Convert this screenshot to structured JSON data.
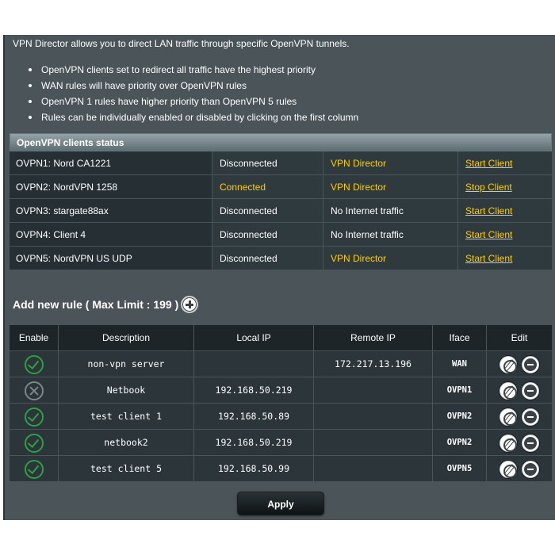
{
  "intro": "VPN Director allows you to direct LAN traffic through specific OpenVPN tunnels.",
  "bullets": [
    "OpenVPN clients set to redirect all traffic have the highest priority",
    "WAN rules will have priority over OpenVPN rules",
    "OpenVPN 1 rules have higher priority than OpenVPN 5 rules",
    "Rules can be individually enabled or disabled by clicking on the first column"
  ],
  "status": {
    "title": "OpenVPN clients status",
    "rows": [
      {
        "name": "OVPN1: Nord CA1221",
        "state": "Disconnected",
        "mode": "VPN Director",
        "action": "Start Client"
      },
      {
        "name": "OVPN2: NordVPN 1258",
        "state": "Connected",
        "mode": "VPN Director",
        "action": "Stop Client"
      },
      {
        "name": "OVPN3: stargate88ax",
        "state": "Disconnected",
        "mode": "No Internet traffic",
        "action": "Start Client"
      },
      {
        "name": "OVPN4: Client 4",
        "state": "Disconnected",
        "mode": "No Internet traffic",
        "action": "Start Client"
      },
      {
        "name": "OVPN5: NordVPN US UDP",
        "state": "Disconnected",
        "mode": "VPN Director",
        "action": "Start Client"
      }
    ]
  },
  "add_rule": {
    "label": "Add new rule ( Max Limit : 199 )",
    "icon": "plus-circle-icon"
  },
  "rules": {
    "headers": {
      "enable": "Enable",
      "description": "Description",
      "local_ip": "Local IP",
      "remote_ip": "Remote IP",
      "iface": "Iface",
      "edit": "Edit"
    },
    "rows": [
      {
        "enabled": true,
        "description": "non-vpn server",
        "local_ip": "",
        "remote_ip": "172.217.13.196",
        "iface": "WAN"
      },
      {
        "enabled": false,
        "description": "Netbook",
        "local_ip": "192.168.50.219",
        "remote_ip": "",
        "iface": "OVPN1"
      },
      {
        "enabled": true,
        "description": "test client 1",
        "local_ip": "192.168.50.89",
        "remote_ip": "",
        "iface": "OVPN2"
      },
      {
        "enabled": true,
        "description": "netbook2",
        "local_ip": "192.168.50.219",
        "remote_ip": "",
        "iface": "OVPN2"
      },
      {
        "enabled": true,
        "description": "test client 5",
        "local_ip": "192.168.50.99",
        "remote_ip": "",
        "iface": "OVPN5"
      }
    ]
  },
  "apply_label": "Apply",
  "colors": {
    "panel": "#4b5458",
    "highlight": "#ffcc00",
    "enabled": "#2ea043",
    "disabled": "#7d878b"
  }
}
